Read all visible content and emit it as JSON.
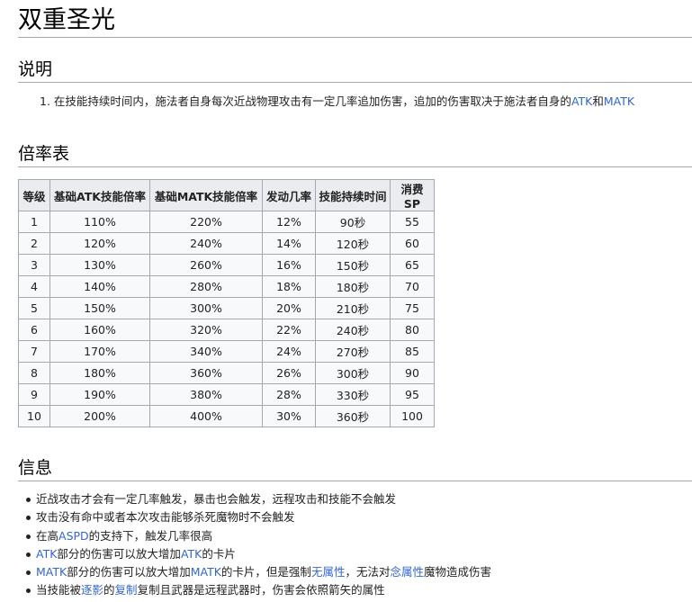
{
  "title": "双重圣光",
  "sections": {
    "description": {
      "heading": "说明",
      "items": [
        {
          "number": "1.",
          "text_before": "在技能持续时间内，施法者自身每次近战物理攻击有一定几率追加伤害，追加的伤害取决于施法者自身的",
          "link1": "ATK",
          "text_mid": "和",
          "link2": "MATK"
        }
      ]
    },
    "rate_table": {
      "heading": "倍率表",
      "headers": [
        "等级",
        "基础ATK技能倍率",
        "基础MATK技能倍率",
        "发动几率",
        "技能持续时间",
        "消费SP"
      ],
      "rows": [
        [
          "1",
          "110%",
          "220%",
          "12%",
          "90秒",
          "55"
        ],
        [
          "2",
          "120%",
          "240%",
          "14%",
          "120秒",
          "60"
        ],
        [
          "3",
          "130%",
          "260%",
          "16%",
          "150秒",
          "65"
        ],
        [
          "4",
          "140%",
          "280%",
          "18%",
          "180秒",
          "70"
        ],
        [
          "5",
          "150%",
          "300%",
          "20%",
          "210秒",
          "75"
        ],
        [
          "6",
          "160%",
          "320%",
          "22%",
          "240秒",
          "80"
        ],
        [
          "7",
          "170%",
          "340%",
          "24%",
          "270秒",
          "85"
        ],
        [
          "8",
          "180%",
          "360%",
          "26%",
          "300秒",
          "90"
        ],
        [
          "9",
          "190%",
          "380%",
          "28%",
          "330秒",
          "95"
        ],
        [
          "10",
          "200%",
          "400%",
          "30%",
          "360秒",
          "100"
        ]
      ]
    },
    "info": {
      "heading": "信息",
      "items": [
        [
          {
            "t": "近战攻击才会有一定几率触发，暴击也会触发，远程攻击和技能不会触发"
          }
        ],
        [
          {
            "t": "攻击没有命中或者本次攻击能够杀死魔物时不会触发"
          }
        ],
        [
          {
            "t": "在高"
          },
          {
            "t": "ASPD",
            "link": true
          },
          {
            "t": "的支持下，触发几率很高"
          }
        ],
        [
          {
            "t": "ATK",
            "link": true
          },
          {
            "t": "部分的伤害可以放大增加"
          },
          {
            "t": "ATK",
            "link": true
          },
          {
            "t": "的卡片"
          }
        ],
        [
          {
            "t": "MATK",
            "link": true
          },
          {
            "t": "部分的伤害可以放大增加"
          },
          {
            "t": "MATK",
            "link": true
          },
          {
            "t": "的卡片，但是强制"
          },
          {
            "t": "无属性",
            "link": true
          },
          {
            "t": "，无法对"
          },
          {
            "t": "念属性",
            "link": true
          },
          {
            "t": "魔物造成伤害"
          }
        ],
        [
          {
            "t": "当技能被"
          },
          {
            "t": "逐影",
            "link": true
          },
          {
            "t": "的"
          },
          {
            "t": "复制",
            "link": true
          },
          {
            "t": "复制且武器是远程武器时，伤害会依照箭矢的属性"
          }
        ]
      ]
    }
  }
}
